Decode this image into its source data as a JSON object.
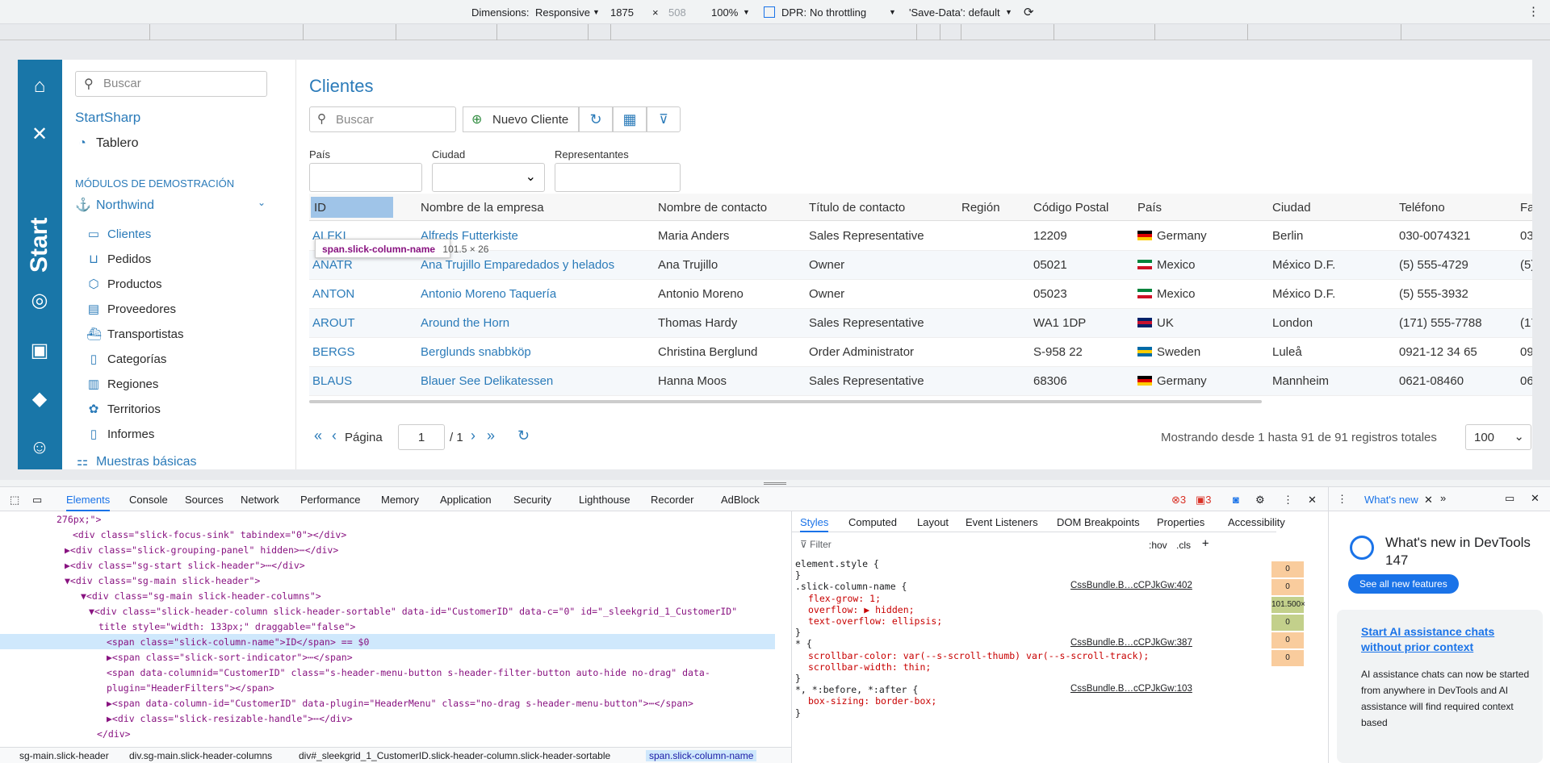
{
  "devtools_toolbar": {
    "dimensions_label": "Dimensions:",
    "dimensions_value": "Responsive",
    "width": "1875",
    "x": "×",
    "height": "508",
    "zoom": "100%",
    "dpr_label": "DPR:",
    "throttle": "No throttling",
    "savedata": "'Save-Data': default"
  },
  "sidebar": {
    "search_placeholder": "Buscar",
    "brand": "StartSharp",
    "rail_brand": "Start",
    "items": [
      {
        "label": "Tablero",
        "icon": "dashboard-icon"
      },
      {
        "label": "MÓDULOS DE DEMOSTRACIÓN"
      },
      {
        "label": "Northwind",
        "icon": "anchor-icon"
      },
      {
        "label": "Clientes",
        "icon": "table-icon"
      },
      {
        "label": "Pedidos",
        "icon": "cart-icon"
      },
      {
        "label": "Productos",
        "icon": "box-icon"
      },
      {
        "label": "Proveedores",
        "icon": "truck-icon"
      },
      {
        "label": "Transportistas",
        "icon": "ship-icon"
      },
      {
        "label": "Categorías",
        "icon": "category-icon"
      },
      {
        "label": "Regiones",
        "icon": "map-icon"
      },
      {
        "label": "Territorios",
        "icon": "globe-icon"
      },
      {
        "label": "Informes",
        "icon": "report-icon"
      },
      {
        "label": "Muestras básicas"
      }
    ]
  },
  "main": {
    "title": "Clientes",
    "search_placeholder": "Buscar",
    "new_button": "Nuevo Cliente",
    "filters": {
      "country": "País",
      "city": "Ciudad",
      "reps": "Representantes"
    },
    "tooltip": {
      "selector": "span.slick-column-name",
      "size": "101.5 × 26"
    },
    "columns": [
      "ID",
      "Nombre de la empresa",
      "Nombre de contacto",
      "Título de contacto",
      "Región",
      "Código Postal",
      "País",
      "Ciudad",
      "Teléfono",
      "Fa"
    ],
    "rows": [
      {
        "id": "ALFKI",
        "company": "Alfreds Futterkiste",
        "contact": "Maria Anders",
        "title": "Sales Representative",
        "region": "",
        "postal": "12209",
        "country": "Germany",
        "flag": "de",
        "city": "Berlin",
        "phone": "030-0074321",
        "fax": "03"
      },
      {
        "id": "ANATR",
        "company": "Ana Trujillo Emparedados y helados",
        "contact": "Ana Trujillo",
        "title": "Owner",
        "region": "",
        "postal": "05021",
        "country": "Mexico",
        "flag": "mx",
        "city": "México D.F.",
        "phone": "(5) 555-4729",
        "fax": "(5)"
      },
      {
        "id": "ANTON",
        "company": "Antonio Moreno Taquería",
        "contact": "Antonio Moreno",
        "title": "Owner",
        "region": "",
        "postal": "05023",
        "country": "Mexico",
        "flag": "mx",
        "city": "México D.F.",
        "phone": "(5) 555-3932",
        "fax": ""
      },
      {
        "id": "AROUT",
        "company": "Around the Horn",
        "contact": "Thomas Hardy",
        "title": "Sales Representative",
        "region": "",
        "postal": "WA1 1DP",
        "country": "UK",
        "flag": "uk",
        "city": "London",
        "phone": "(171) 555-7788",
        "fax": "(17"
      },
      {
        "id": "BERGS",
        "company": "Berglunds snabbköp",
        "contact": "Christina Berglund",
        "title": "Order Administrator",
        "region": "",
        "postal": "S-958 22",
        "country": "Sweden",
        "flag": "se",
        "city": "Luleå",
        "phone": "0921-12 34 65",
        "fax": "09"
      },
      {
        "id": "BLAUS",
        "company": "Blauer See Delikatessen",
        "contact": "Hanna Moos",
        "title": "Sales Representative",
        "region": "",
        "postal": "68306",
        "country": "Germany",
        "flag": "de",
        "city": "Mannheim",
        "phone": "0621-08460",
        "fax": "06"
      }
    ],
    "pager": {
      "page_label": "Página",
      "page": "1",
      "of": "/ 1",
      "status": "Mostrando desde 1 hasta 91 de 91 registros totales",
      "page_size": "100"
    }
  },
  "devtools": {
    "tabs": [
      "Elements",
      "Console",
      "Sources",
      "Network",
      "Performance",
      "Memory",
      "Application",
      "Security",
      "Lighthouse",
      "Recorder",
      "AdBlock"
    ],
    "errors": "3",
    "warnings": "3",
    "dom_lines": [
      "276px;\">",
      "<div class=\"slick-focus-sink\" tabindex=\"0\"></div>",
      "▶<div class=\"slick-grouping-panel\" hidden>⋯</div>",
      "▶<div class=\"sg-start slick-header\">⋯</div>",
      "▼<div class=\"sg-main slick-header\">",
      "▼<div class=\"sg-main slick-header-columns\">",
      "▼<div class=\"slick-header-column slick-header-sortable\" data-id=\"CustomerID\" data-c=\"0\" id=\"_sleekgrid_1_CustomerID\"",
      "title style=\"width: 133px;\" draggable=\"false\">",
      "<span class=\"slick-column-name\">ID</span> == $0",
      "▶<span class=\"slick-sort-indicator\">⋯</span>",
      "<span data-columnid=\"CustomerID\" class=\"s-header-menu-button s-header-filter-button auto-hide no-drag\" data-",
      "plugin=\"HeaderFilters\"></span>",
      "▶<span data-column-id=\"CustomerID\" data-plugin=\"HeaderMenu\" class=\"no-drag s-header-menu-button\">⋯</span>",
      "▶<div class=\"slick-resizable-handle\">⋯</div>",
      "</div>"
    ],
    "crumbs": [
      "sg-main.slick-header",
      "div.sg-main.slick-header-columns",
      "div#_sleekgrid_1_CustomerID.slick-header-column.slick-header-sortable",
      "span.slick-column-name"
    ],
    "styles_tabs": [
      "Styles",
      "Computed",
      "Layout",
      "Event Listeners",
      "DOM Breakpoints",
      "Properties",
      "Accessibility"
    ],
    "filter_placeholder": "Filter",
    "hov": ":hov",
    "cls": ".cls",
    "style_lines": [
      {
        "t": "element.style {",
        "s": ""
      },
      {
        "t": "}",
        "s": ""
      },
      {
        "t": ".slick-column-name {",
        "s": "CssBundle.B…cCPJkGw:402"
      },
      {
        "t": "flex-grow: 1;",
        "s": ""
      },
      {
        "t": "overflow: ▶ hidden;",
        "s": ""
      },
      {
        "t": "text-overflow: ellipsis;",
        "s": ""
      },
      {
        "t": "}",
        "s": ""
      },
      {
        "t": "* {",
        "s": "CssBundle.B…cCPJkGw:387"
      },
      {
        "t": "scrollbar-color: var(--s-scroll-thumb) var(--s-scroll-track);",
        "s": ""
      },
      {
        "t": "scrollbar-width: thin;",
        "s": ""
      },
      {
        "t": "}",
        "s": ""
      },
      {
        "t": "*, *:before, *:after {",
        "s": "CssBundle.B…cCPJkGw:103"
      },
      {
        "t": "box-sizing: border-box;",
        "s": ""
      },
      {
        "t": "}",
        "s": ""
      }
    ],
    "box_values": [
      "0",
      "0",
      "101.500×",
      "0",
      "0",
      "0"
    ],
    "whats_new": {
      "tab": "What's new",
      "title": "What's new in DevTools 147",
      "button": "See all new features",
      "link": "Start AI assistance chats without prior context",
      "body": "AI assistance chats can now be started from anywhere in DevTools and AI assistance will find required context based"
    }
  }
}
